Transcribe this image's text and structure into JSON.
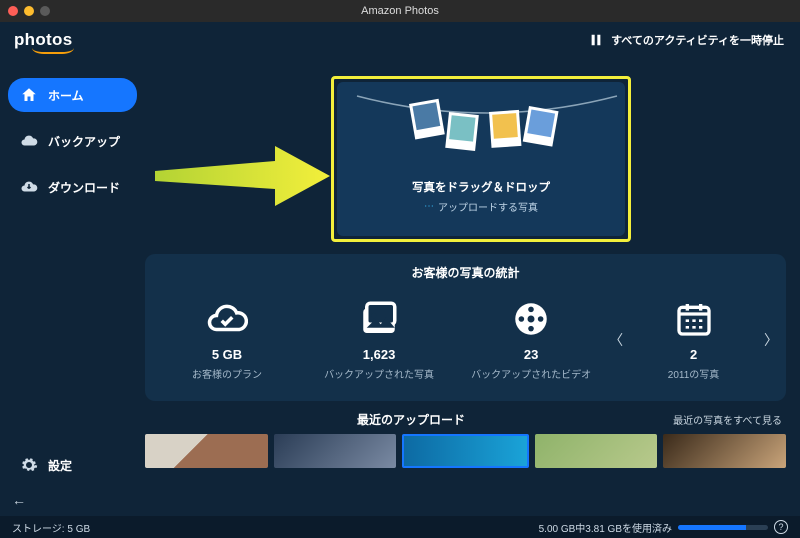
{
  "app": {
    "title": "Amazon Photos",
    "logo": "photos"
  },
  "header": {
    "pause_label": "すべてのアクティビティを一時停止"
  },
  "sidebar": {
    "items": [
      {
        "label": "ホーム",
        "active": true
      },
      {
        "label": "バックアップ",
        "active": false
      },
      {
        "label": "ダウンロード",
        "active": false
      }
    ],
    "settings_label": "設定"
  },
  "dropzone": {
    "title": "写真をドラッグ＆ドロップ",
    "subtitle": "アップロードする写真"
  },
  "stats": {
    "title": "お客様の写真の統計",
    "items": [
      {
        "value": "5 GB",
        "label": "お客様のプラン"
      },
      {
        "value": "1,623",
        "label": "バックアップされた写真"
      },
      {
        "value": "23",
        "label": "バックアップされたビデオ"
      },
      {
        "value": "2",
        "label": "2011の写真"
      }
    ]
  },
  "recent": {
    "title": "最近のアップロード",
    "view_all": "最近の写真をすべて見る"
  },
  "footer": {
    "storage_label": "ストレージ: 5 GB",
    "usage_label": "5.00 GB中3.81 GBを使用済み",
    "usage_percent": 76
  }
}
